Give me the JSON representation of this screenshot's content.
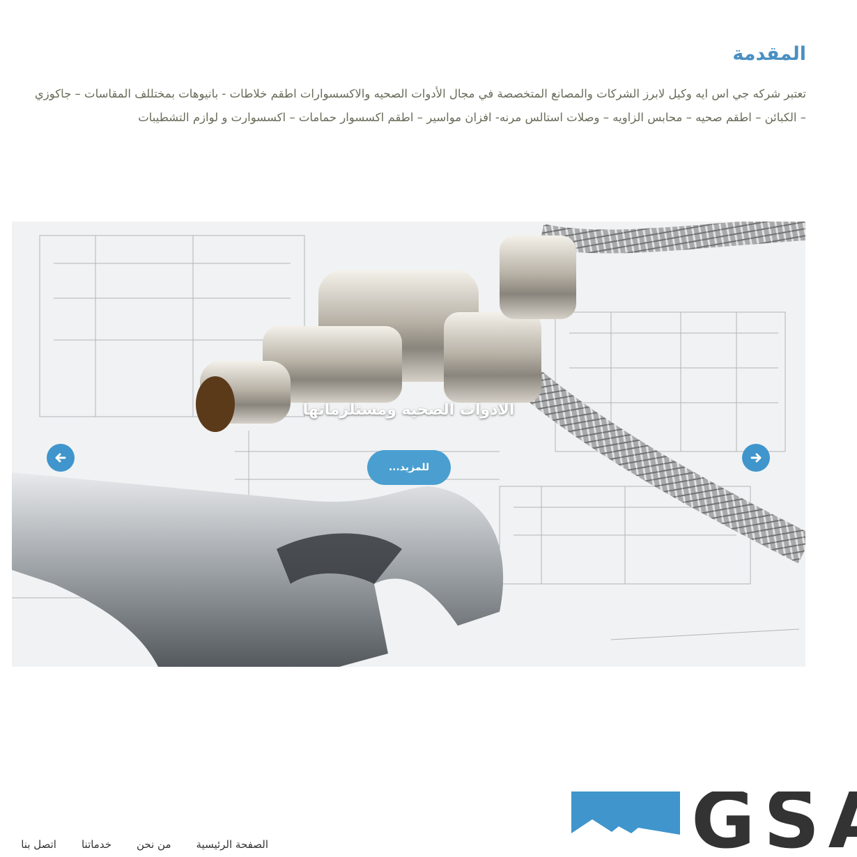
{
  "intro": {
    "title": "المقدمة",
    "body": "تعتبر شركه جي اس ايه وكيل لابرز الشركات والمصانع المتخصصة في مجال الأدوات الصحيه والاكسسوارات اطقم خلاطات - بانيوهات بمختللف المقاسات – جاكوزي – الكبائن – اطقم صحيه – محابس الزاويه – وصلات استالس مرنه- افزان مواسير – اطقم اكسسوار حمامات – اكسسوارت و لوازم التشطيبات"
  },
  "slider": {
    "caption": "الادوات الصحيه ومستلزماتها",
    "more_label": "للمزيد...",
    "prev_icon": "arrow-left-icon",
    "next_icon": "arrow-right-icon",
    "accent": "#3f95cc"
  },
  "footer": {
    "logo_text": "GSA",
    "logo_color": "#3f95cc",
    "nav": [
      "الصفحة الرئيسية",
      "من نحن",
      "خدماتنا",
      "اتصل بنا"
    ]
  }
}
